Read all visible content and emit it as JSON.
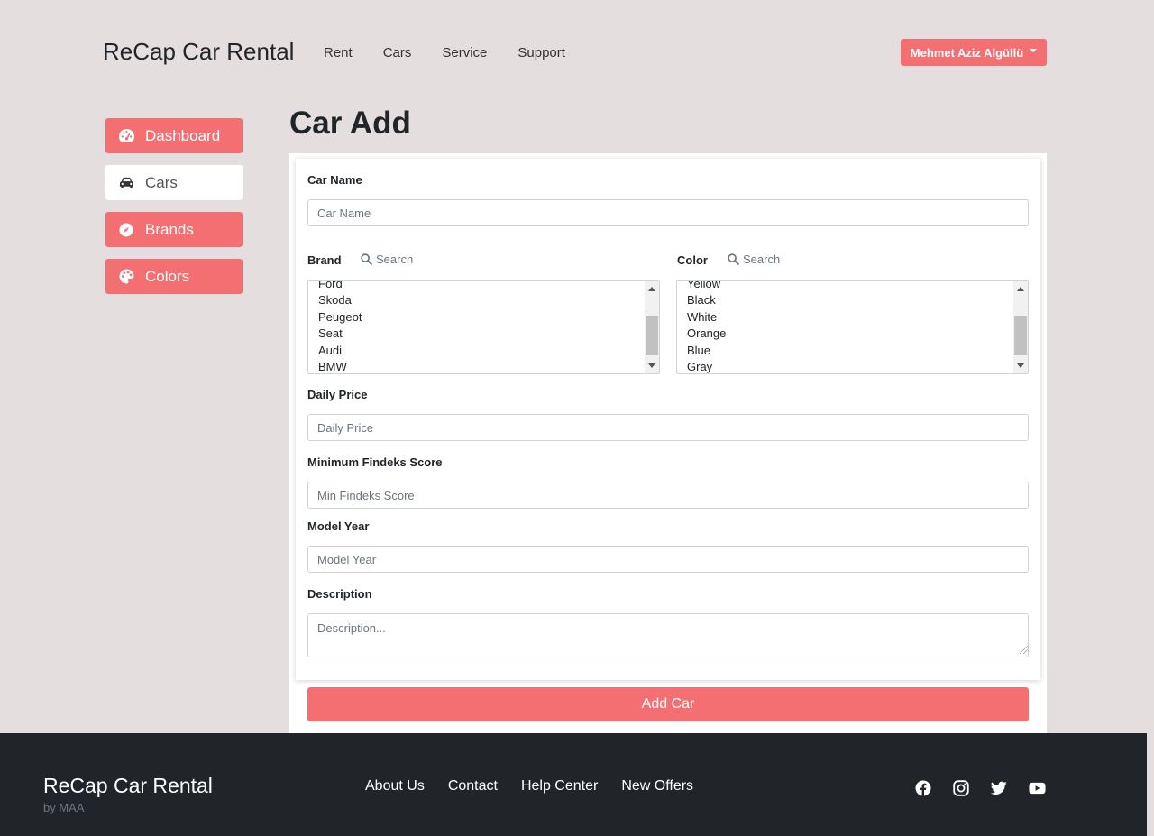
{
  "header": {
    "brand": "ReCap Car Rental",
    "nav": [
      "Rent",
      "Cars",
      "Service",
      "Support"
    ],
    "user": "Mehmet Aziz Algüllü"
  },
  "sidebar": {
    "items": [
      {
        "label": "Dashboard",
        "icon": "gauge-icon"
      },
      {
        "label": "Cars",
        "icon": "car-icon"
      },
      {
        "label": "Brands",
        "icon": "compass-icon"
      },
      {
        "label": "Colors",
        "icon": "palette-icon"
      }
    ]
  },
  "page": {
    "title": "Car Add"
  },
  "form": {
    "car_name": {
      "label": "Car Name",
      "placeholder": "Car Name"
    },
    "brand": {
      "label": "Brand",
      "search_placeholder": "Search",
      "options": [
        "Ford",
        "Skoda",
        "Peugeot",
        "Seat",
        "Audi",
        "BMW"
      ]
    },
    "color": {
      "label": "Color",
      "search_placeholder": "Search",
      "options": [
        "Yellow",
        "Black",
        "White",
        "Orange",
        "Blue",
        "Gray"
      ]
    },
    "daily_price": {
      "label": "Daily Price",
      "placeholder": "Daily Price"
    },
    "min_findeks": {
      "label": "Minimum Findeks Score",
      "placeholder": "Min Findeks Score"
    },
    "model_year": {
      "label": "Model Year",
      "placeholder": "Model Year"
    },
    "description": {
      "label": "Description",
      "placeholder": "Description..."
    },
    "submit": "Add Car"
  },
  "footer": {
    "brand": "ReCap Car Rental",
    "sub": "by MAA",
    "links": [
      "About Us",
      "Contact",
      "Help Center",
      "New Offers"
    ],
    "social": [
      "facebook-icon",
      "instagram-icon",
      "twitter-icon",
      "youtube-icon"
    ]
  },
  "colors": {
    "accent": "#f36f72",
    "background": "#e4dedf",
    "footer": "#212529"
  }
}
